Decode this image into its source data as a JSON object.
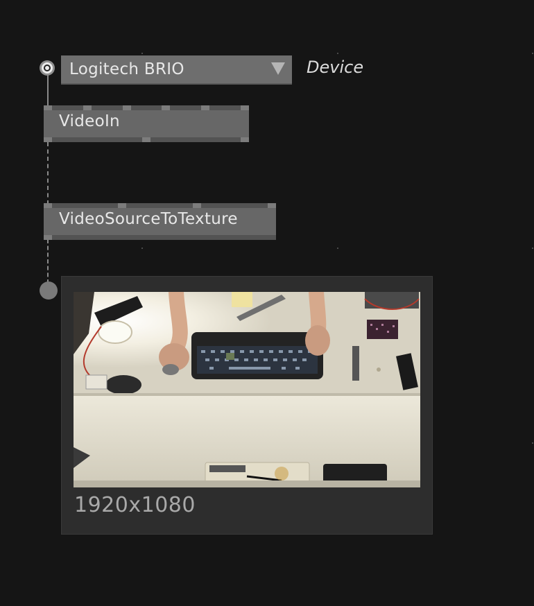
{
  "device_pin": {
    "selected_value": "Logitech BRIO",
    "label": "Device",
    "arrow_icon": "dropdown-triangle"
  },
  "nodes": [
    {
      "title": "VideoIn"
    },
    {
      "title": "VideoSourceToTexture"
    }
  ],
  "preview": {
    "resolution": "1920x1080"
  },
  "colors": {
    "background": "#151515",
    "node_fill": "#676767",
    "node_bar": "#535353",
    "link": "#8a8a8a",
    "panel": "#2d2d2d"
  }
}
